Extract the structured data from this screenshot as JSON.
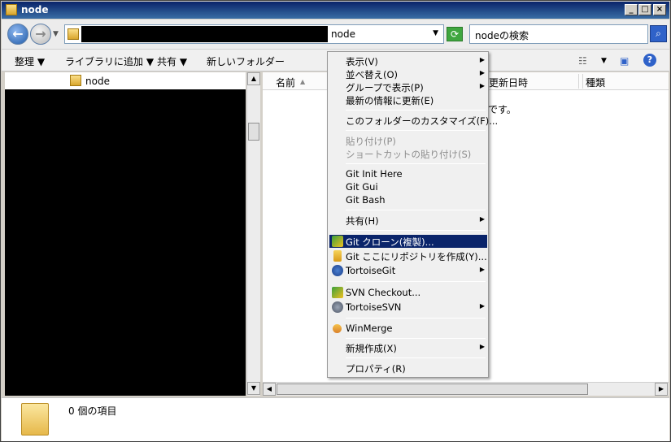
{
  "window": {
    "title": "node"
  },
  "address": {
    "path_text": "node",
    "search_placeholder": "nodeの検索"
  },
  "toolbar": {
    "organize": "整理 ▼",
    "include_library": "ライブラリに追加 ▼",
    "share": "共有 ▼",
    "new_folder": "新しいフォルダー"
  },
  "nav": {
    "root_label": "node"
  },
  "columns": {
    "name": "名前",
    "modified": "更新日時",
    "type": "種類"
  },
  "content": {
    "empty_tail": "です。"
  },
  "details": {
    "item_count": "0 個の項目"
  },
  "context_menu": {
    "view": "表示(V)",
    "sort_by": "並べ替え(O)",
    "group_by": "グループで表示(P)",
    "refresh": "最新の情報に更新(E)",
    "customize": "このフォルダーのカスタマイズ(F)...",
    "paste": "貼り付け(P)",
    "paste_shortcut": "ショートカットの貼り付け(S)",
    "git_init": "Git Init Here",
    "git_gui": "Git Gui",
    "git_bash": "Git Bash",
    "share": "共有(H)",
    "git_clone": "Git クローン(複製)...",
    "git_create_repo": "Git ここにリポジトリを作成(Y)...",
    "tortoise_git": "TortoiseGit",
    "svn_checkout": "SVN Checkout...",
    "tortoise_svn": "TortoiseSVN",
    "winmerge": "WinMerge",
    "new": "新規作成(X)",
    "properties": "プロパティ(R)"
  }
}
